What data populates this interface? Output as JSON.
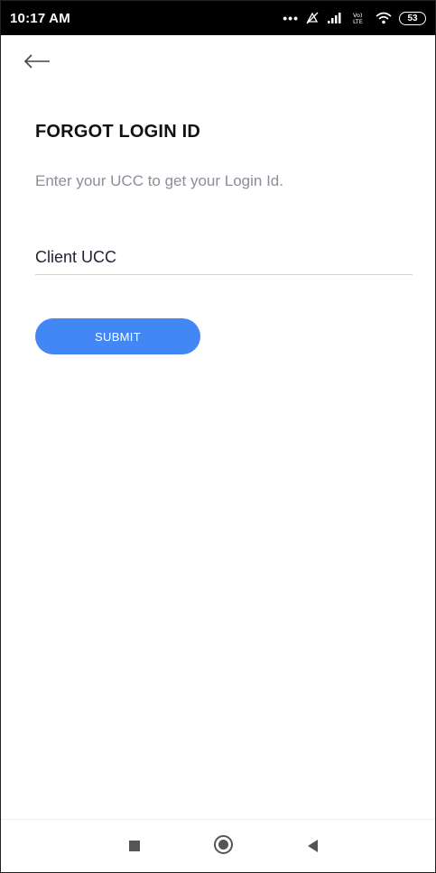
{
  "status_bar": {
    "time": "10:17 AM",
    "battery": "53"
  },
  "header": {
    "back_icon": "arrow-left-icon"
  },
  "main": {
    "title": "FORGOT LOGIN ID",
    "subtitle": "Enter your UCC to get your Login Id.",
    "ucc_field": {
      "placeholder": "Client UCC",
      "value": ""
    },
    "submit_label": "SUBMIT"
  },
  "nav_bar": {
    "icons": [
      "recent-apps-icon",
      "home-icon",
      "back-icon"
    ]
  },
  "colors": {
    "accent": "#4387f5",
    "title": "#111111",
    "subtitle": "#8a8f99",
    "status_bar_bg": "#000000"
  }
}
